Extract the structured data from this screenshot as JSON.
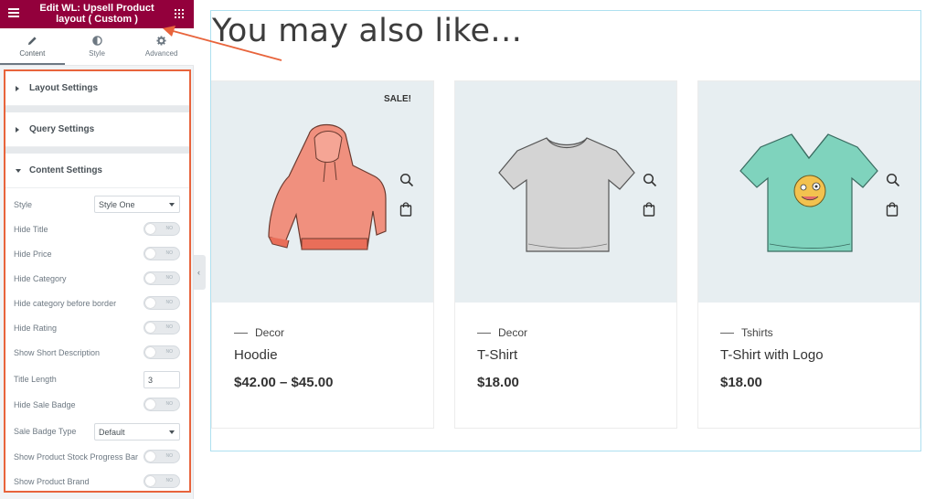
{
  "header": {
    "title": "Edit WL: Upsell Product layout ( Custom )"
  },
  "tabs": [
    {
      "label": "Content",
      "icon": "pencil-icon"
    },
    {
      "label": "Style",
      "icon": "half-circle-icon"
    },
    {
      "label": "Advanced",
      "icon": "gear-icon"
    }
  ],
  "sections": {
    "layout": "Layout Settings",
    "query": "Query Settings",
    "content": "Content Settings"
  },
  "controls": {
    "style": {
      "label": "Style",
      "value": "Style One"
    },
    "hide_title": {
      "label": "Hide Title",
      "toggle": "NO"
    },
    "hide_price": {
      "label": "Hide Price",
      "toggle": "NO"
    },
    "hide_category": {
      "label": "Hide Category",
      "toggle": "NO"
    },
    "hide_category_border": {
      "label": "Hide category before border",
      "toggle": "NO"
    },
    "hide_rating": {
      "label": "Hide Rating",
      "toggle": "NO"
    },
    "show_short_desc": {
      "label": "Show Short Description",
      "toggle": "NO"
    },
    "title_length": {
      "label": "Title Length",
      "value": "3"
    },
    "hide_sale_badge": {
      "label": "Hide Sale Badge",
      "toggle": "NO"
    },
    "sale_badge_type": {
      "label": "Sale Badge Type",
      "value": "Default"
    },
    "show_stock_bar": {
      "label": "Show Product Stock Progress Bar",
      "toggle": "NO"
    },
    "show_brand": {
      "label": "Show Product Brand",
      "toggle": "NO"
    }
  },
  "main": {
    "heading": "You may also like…",
    "products": [
      {
        "badge": "SALE!",
        "category": "Decor",
        "name": "Hoodie",
        "price": "$42.00 – $45.00"
      },
      {
        "category": "Decor",
        "name": "T-Shirt",
        "price": "$18.00"
      },
      {
        "category": "Tshirts",
        "name": "T-Shirt with Logo",
        "price": "$18.00"
      }
    ]
  },
  "colors": {
    "header_bg": "#93003c",
    "highlight": "#e8643c",
    "image_bg": "#e7eef1",
    "hoodie": "#f0907e",
    "tshirt": "#d4d4d4",
    "logo_tshirt": "#7fd3bd"
  }
}
